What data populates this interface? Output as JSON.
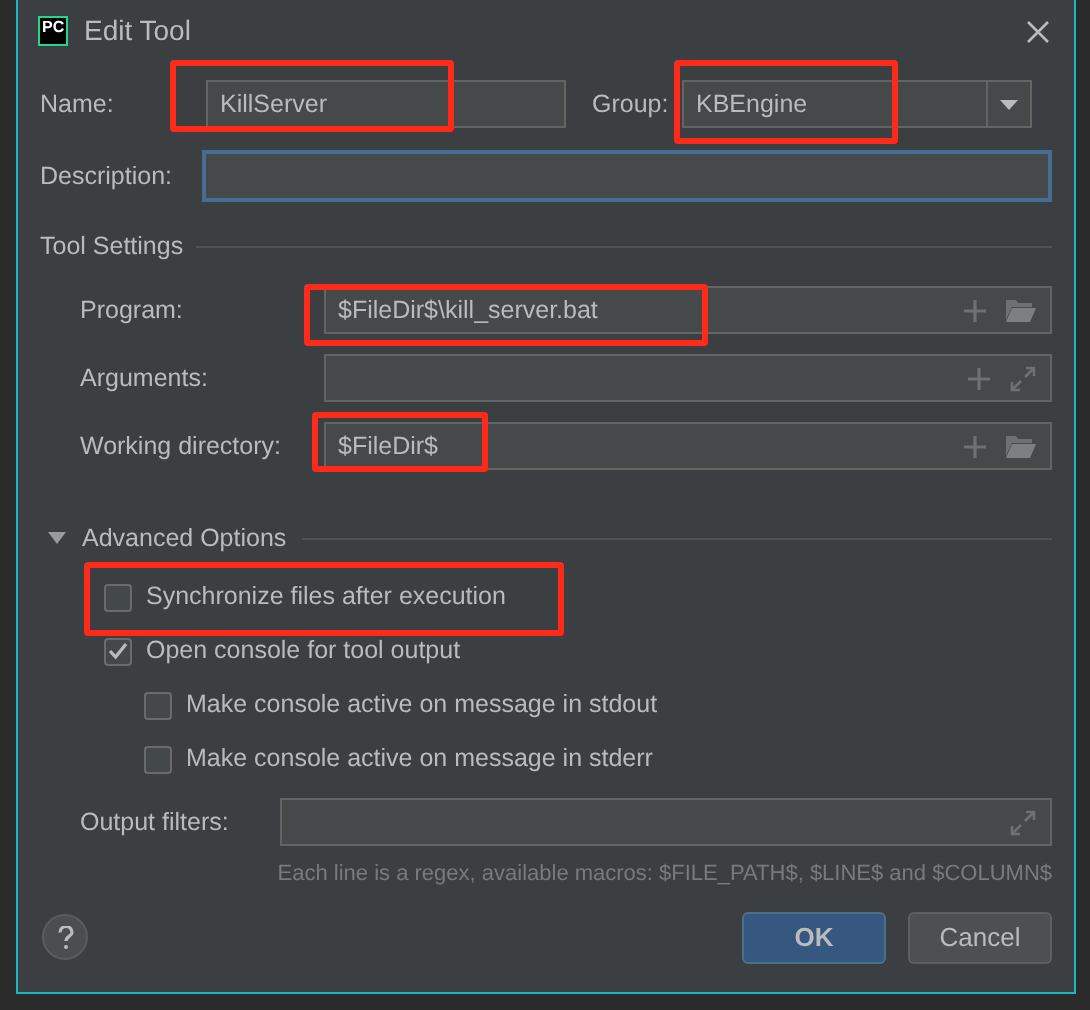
{
  "window": {
    "logo_text": "PC",
    "title": "Edit Tool"
  },
  "name": {
    "label": "Name:",
    "value": "KillServer",
    "highlighted": true
  },
  "group": {
    "label": "Group:",
    "value": "KBEngine",
    "highlighted": true
  },
  "description": {
    "label": "Description:",
    "focused": true
  },
  "tool_settings": {
    "title": "Tool Settings",
    "fields": [
      {
        "label": "Program:",
        "value": "$FileDir$\\kill_server.bat",
        "kind": "browse",
        "highlighted": true
      },
      {
        "label": "Arguments:",
        "kind": "expand",
        "highlighted": false
      },
      {
        "label": "Working directory:",
        "value": "$FileDir$",
        "kind": "browse",
        "highlighted": true
      }
    ]
  },
  "advanced": {
    "title": "Advanced Options",
    "expanded": true,
    "options": [
      {
        "label": "Synchronize files after execution",
        "checked": false,
        "highlighted": true
      },
      {
        "label": "Open console for tool output",
        "checked": true,
        "highlighted": false,
        "children": [
          {
            "label": "Make console active on message in stdout",
            "checked": false,
            "highlighted": false
          },
          {
            "label": "Make console active on message in stderr",
            "checked": false,
            "highlighted": false
          }
        ]
      }
    ]
  },
  "output_filters": {
    "label": "Output filters:",
    "hint": "Each line is a regex, available macros: $FILE_PATH$, $LINE$ and $COLUMN$"
  },
  "buttons": [
    {
      "label": "OK",
      "primary": true
    },
    {
      "label": "Cancel",
      "primary": false
    }
  ]
}
